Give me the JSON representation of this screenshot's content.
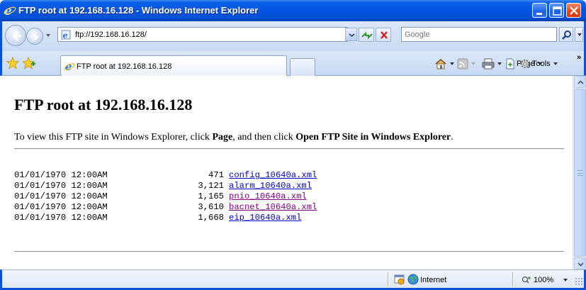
{
  "window": {
    "title": "FTP root at 192.168.16.128 - Windows Internet Explorer"
  },
  "address_bar": {
    "url": "ftp://192.168.16.128/",
    "search_placeholder": "Google"
  },
  "tabs": [
    {
      "label": "FTP root at 192.168.16.128"
    }
  ],
  "command_bar": {
    "page_label": "Page",
    "tools_label": "Tools"
  },
  "page": {
    "heading": "FTP root at 192.168.16.128",
    "instructions": {
      "prefix": "To view this FTP site in Windows Explorer, click ",
      "page_word": "Page",
      "middle": ", and then click ",
      "action": "Open FTP Site in Windows Explorer",
      "suffix": "."
    },
    "files": [
      {
        "date": "01/01/1970 12:00AM",
        "size": "471",
        "name": "config_10640a.xml",
        "visited": false
      },
      {
        "date": "01/01/1970 12:00AM",
        "size": "3,121",
        "name": "alarm_10640a.xml",
        "visited": false
      },
      {
        "date": "01/01/1970 12:00AM",
        "size": "1,165",
        "name": "pnio_10640a.xml",
        "visited": true
      },
      {
        "date": "01/01/1970 12:00AM",
        "size": "3,610",
        "name": "bacnet_10640a.xml",
        "visited": true
      },
      {
        "date": "01/01/1970 12:00AM",
        "size": "1,668",
        "name": "eip_10640a.xml",
        "visited": false
      }
    ]
  },
  "status_bar": {
    "zone": "Internet",
    "zoom": "100%"
  },
  "icons": {
    "back": "back-arrow-icon",
    "forward": "forward-arrow-icon",
    "refresh": "refresh-icon",
    "stop": "stop-icon",
    "search": "search-icon",
    "favorites": "favorites-star-icon",
    "add_favorite": "add-favorite-icon",
    "home": "home-icon",
    "feeds": "rss-feed-icon",
    "print": "print-icon",
    "page": "page-icon",
    "tools": "gear-icon"
  },
  "colors": {
    "titlebar": "#0554e3",
    "link": "#0000cc",
    "visited_link": "#800080"
  }
}
